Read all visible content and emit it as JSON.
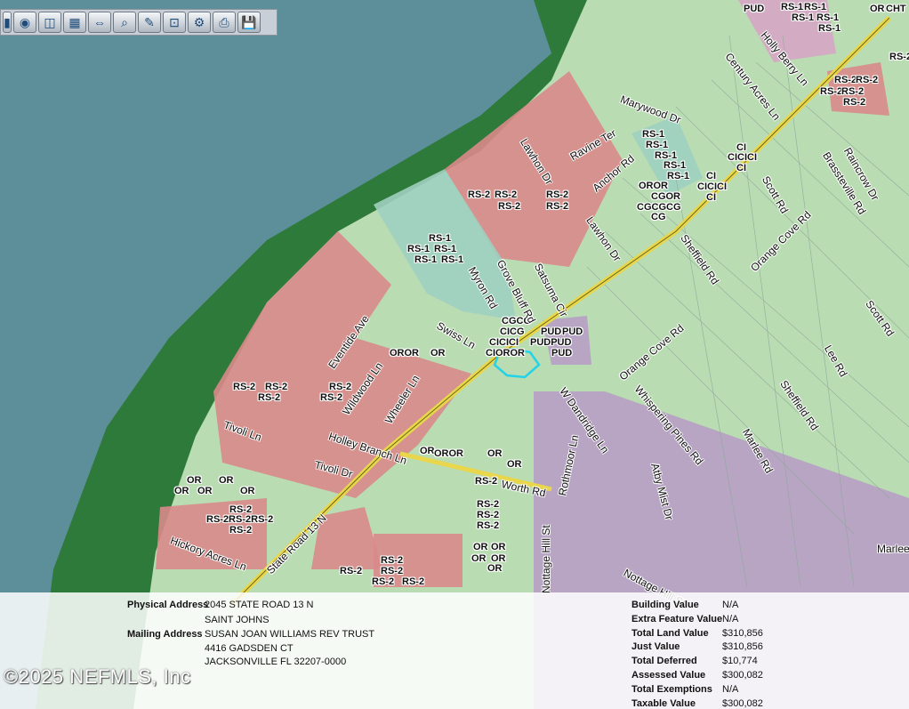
{
  "toolbar": {
    "buttons": [
      {
        "name": "partial-tool-icon",
        "glyph": "▮"
      },
      {
        "name": "layers-icon",
        "glyph": "◉"
      },
      {
        "name": "camera-icon",
        "glyph": "◫"
      },
      {
        "name": "map-image-icon",
        "glyph": "▦"
      },
      {
        "name": "measure-icon",
        "glyph": "⇔"
      },
      {
        "name": "zoom-search-icon",
        "glyph": "⌕"
      },
      {
        "name": "pencil-icon",
        "glyph": "✎"
      },
      {
        "name": "select-icon",
        "glyph": "⊡"
      },
      {
        "name": "tools-icon",
        "glyph": "⚙"
      },
      {
        "name": "print-icon",
        "glyph": "⎙"
      },
      {
        "name": "save-icon",
        "glyph": "💾"
      }
    ]
  },
  "map": {
    "zones": {
      "z1": "PUD",
      "z2": "RS-1",
      "z3": "RS-1",
      "z4": "RS-1",
      "z5": "RS-1",
      "z6": "RS-1",
      "z7": "OR",
      "z8": "CHT",
      "z9": "RS-2",
      "z10": "RS-2",
      "z11": "RS-2",
      "z12": "RS-2",
      "z13": "RS-2",
      "z14": "RS-2",
      "z15": "RS-1",
      "z16": "RS-1",
      "z17": "RS-1",
      "z18": "RS-1",
      "z19": "RS-1",
      "z20": "CI",
      "z21": "CICICI",
      "z22": "CI",
      "z23": "OROR",
      "z24": "CGOR",
      "z25": "CGCGCG",
      "z26": "CG",
      "z27": "CI",
      "z28": "CICICI",
      "z29": "CI",
      "z30": "RS-2",
      "z31": "RS-2",
      "z32": "RS-2",
      "z33": "RS-2",
      "z34": "RS-2",
      "z35": "RS-1",
      "z36": "RS-1",
      "z37": "RS-1",
      "z38": "RS-1",
      "z39": "RS-1",
      "z40": "CGCG",
      "z41": "CICG",
      "z42": "CICICI",
      "z43": "CIOROR",
      "z44": "PUD",
      "z45": "PUD",
      "z46": "PUDPUD",
      "z47": "PUD",
      "z48": "OROR",
      "z49": "OR",
      "z50": "RS-2",
      "z51": "RS-2",
      "z52": "RS-2",
      "z53": "RS-2",
      "z54": "RS-2",
      "z55": "OR",
      "z56": "OROR",
      "z57": "OR",
      "z58": "OR",
      "z59": "OR",
      "z60": "OR",
      "z61": "OR",
      "z62": "OR",
      "z63": "OR",
      "z64": "RS-2",
      "z65": "RS-2RS-2RS-2",
      "z66": "RS-2",
      "z67": "RS-2",
      "z68": "RS-2",
      "z69": "RS-2",
      "z70": "RS-2",
      "z71": "OR",
      "z72": "OR",
      "z73": "OR",
      "z74": "OR",
      "z75": "OR",
      "z76": "RS-2",
      "z77": "RS-2",
      "z78": "RS-2",
      "z79": "RS-2",
      "z80": "RS-2"
    },
    "roads": {
      "r1": "Holly Berry Ln",
      "r2": "Century Acres Ln",
      "r3": "Marywood Dr",
      "r4": "Lawhon Dr",
      "r5": "Ravine Ter",
      "r6": "Anchor Rd",
      "r7": "Brassteville Rd",
      "r8": "Raincrow Dr",
      "r9": "Scott Rd",
      "r10": "Sheffield Rd",
      "r11": "Orange Cove Rd",
      "r12": "Lawhon Dr",
      "r13": "Myron Rd",
      "r14": "Grove Bluff Rd",
      "r15": "Satsuma Cir",
      "r16": "Swiss Ln",
      "r17": "Eventide Ave",
      "r18": "Wildwood Ln",
      "r19": "Wheeler Ln",
      "r20": "Tivoli Ln",
      "r21": "Holley Branch Ln",
      "r22": "Tivoli Dr",
      "r23": "State Road 13 N",
      "r24": "Hickory Acres Ln",
      "r25": "Worth Rd",
      "r26": "Rothmoor Ln",
      "r27": "W Dandridge Ln",
      "r28": "Orange Cove Rd",
      "r29": "Whispering Pines Rd",
      "r30": "Atby Mist Dr",
      "r31": "Marlee Rd",
      "r32": "Sheffield Rd",
      "r33": "Lee Rd",
      "r34": "Scott Rd",
      "r35": "Nottage Hill St",
      "r36": "Nottage Hill St",
      "r37": "Marlee"
    }
  },
  "property": {
    "physical_address_label": "Physical Address",
    "physical_address_line1": "2045 STATE ROAD 13 N",
    "physical_address_line2": "SAINT JOHNS",
    "mailing_address_label": "Mailing Address",
    "mailing_line1": "SUSAN JOAN WILLIAMS REV TRUST",
    "mailing_line2": "4416 GADSDEN CT",
    "mailing_line3": "JACKSONVILLE FL 32207-0000",
    "values": [
      {
        "label": "Building Value",
        "value": "N/A"
      },
      {
        "label": "Extra Feature Value",
        "value": "N/A"
      },
      {
        "label": "Total Land Value",
        "value": "$310,856"
      },
      {
        "label": "Just Value",
        "value": "$310,856"
      },
      {
        "label": "Total Deferred",
        "value": "$10,774"
      },
      {
        "label": "Assessed Value",
        "value": "$300,082"
      },
      {
        "label": "Total Exemptions",
        "value": "N/A"
      },
      {
        "label": "Taxable Value",
        "value": "$300,082"
      }
    ]
  },
  "copyright": "©2025 NEFMLS, Inc"
}
